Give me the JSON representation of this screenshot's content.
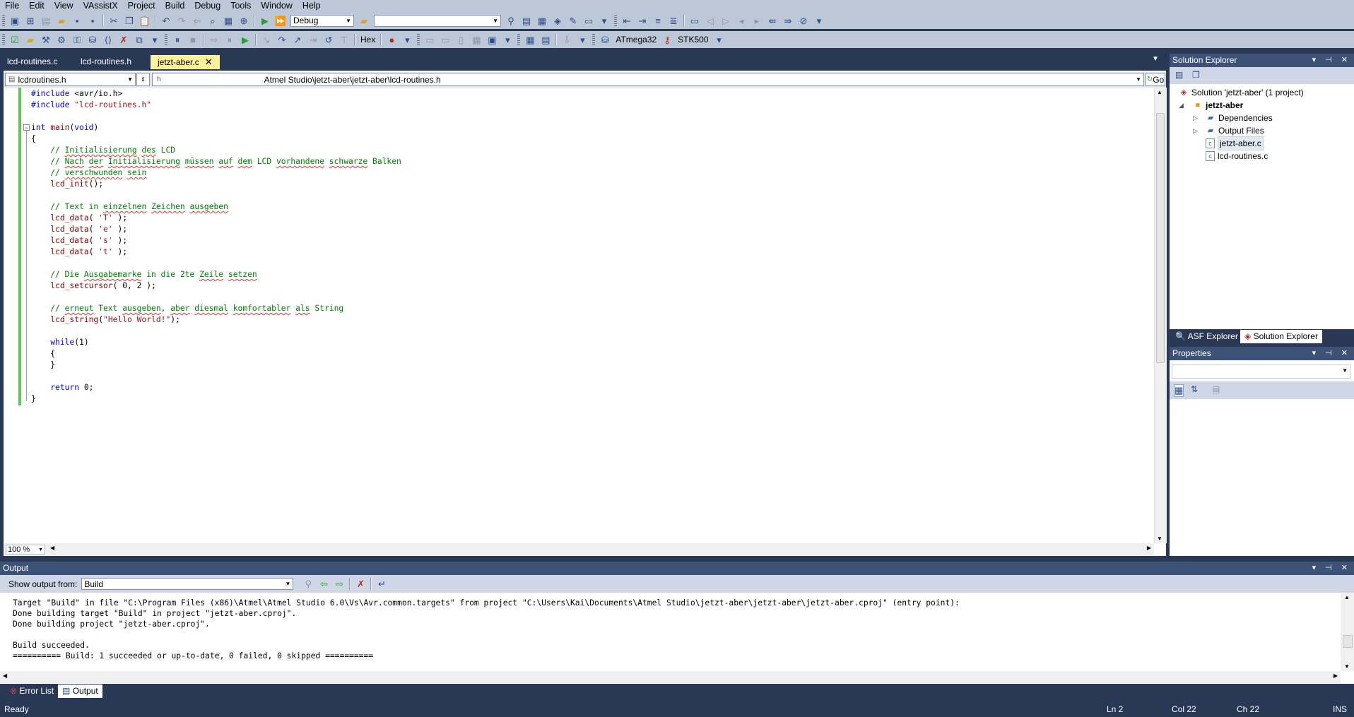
{
  "menu": [
    "File",
    "Edit",
    "View",
    "VAssistX",
    "Project",
    "Build",
    "Debug",
    "Tools",
    "Window",
    "Help"
  ],
  "toolbar": {
    "config": "Debug",
    "platform_value": "",
    "hex_label": "Hex",
    "device_label": "ATmega32",
    "tool_label": "STK500"
  },
  "doc_tabs": [
    {
      "label": "lcd-routines.c"
    },
    {
      "label": "lcd-routines.h"
    },
    {
      "label": "jetzt-aber.c",
      "active": true
    }
  ],
  "navbar": {
    "file_combo": "lcdroutines.h",
    "path": "Atmel Studio\\jetzt-aber\\jetzt-aber\\lcd-routines.h",
    "go_label": "Go"
  },
  "code_lines": [
    "#include <avr/io.h>",
    "#include \"lcd-routines.h\"",
    "",
    "int main(void)",
    "{",
    "    // Initialisierung des LCD",
    "    // Nach der Initialisierung müssen auf dem LCD vorhandene schwarze Balken",
    "    // verschwunden sein",
    "    lcd_init();",
    "",
    "    // Text in einzelnen Zeichen ausgeben",
    "    lcd_data( 'T' );",
    "    lcd_data( 'e' );",
    "    lcd_data( 's' );",
    "    lcd_data( 't' );",
    "",
    "    // Die Ausgabemarke in die 2te Zeile setzen",
    "    lcd_setcursor( 0, 2 );",
    "",
    "    // erneut Text ausgeben, aber diesmal komfortabler als String",
    "    lcd_string(\"Hello World!\");",
    "",
    "    while(1)",
    "    {",
    "    }",
    "",
    "    return 0;",
    "}"
  ],
  "editor": {
    "zoom": "100 %"
  },
  "solution_explorer": {
    "title": "Solution Explorer",
    "solution": "Solution 'jetzt-aber' (1 project)",
    "project": "jetzt-aber",
    "items": [
      "Dependencies",
      "Output Files",
      "jetzt-aber.c",
      "lcd-routines.c"
    ],
    "tabs": [
      "ASF Explorer",
      "Solution Explorer"
    ]
  },
  "properties": {
    "title": "Properties"
  },
  "output": {
    "title": "Output",
    "show_from_label": "Show output from:",
    "source": "Build",
    "lines": [
      "Target \"Build\" in file \"C:\\Program Files (x86)\\Atmel\\Atmel Studio 6.0\\Vs\\Avr.common.targets\" from project \"C:\\Users\\Kai\\Documents\\Atmel Studio\\jetzt-aber\\jetzt-aber\\jetzt-aber.cproj\" (entry point):",
      "Done building target \"Build\" in project \"jetzt-aber.cproj\".",
      "Done building project \"jetzt-aber.cproj\".",
      "",
      "Build succeeded.",
      "========== Build: 1 succeeded or up-to-date, 0 failed, 0 skipped =========="
    ],
    "tabs": [
      "Error List",
      "Output"
    ]
  },
  "status": {
    "ready": "Ready",
    "ln": "Ln 2",
    "col": "Col 22",
    "ch": "Ch 22",
    "ins": "INS"
  },
  "colors": {
    "ide_frame": "#293955",
    "active_tab": "#fff29d",
    "change_margin": "#66c25b"
  }
}
